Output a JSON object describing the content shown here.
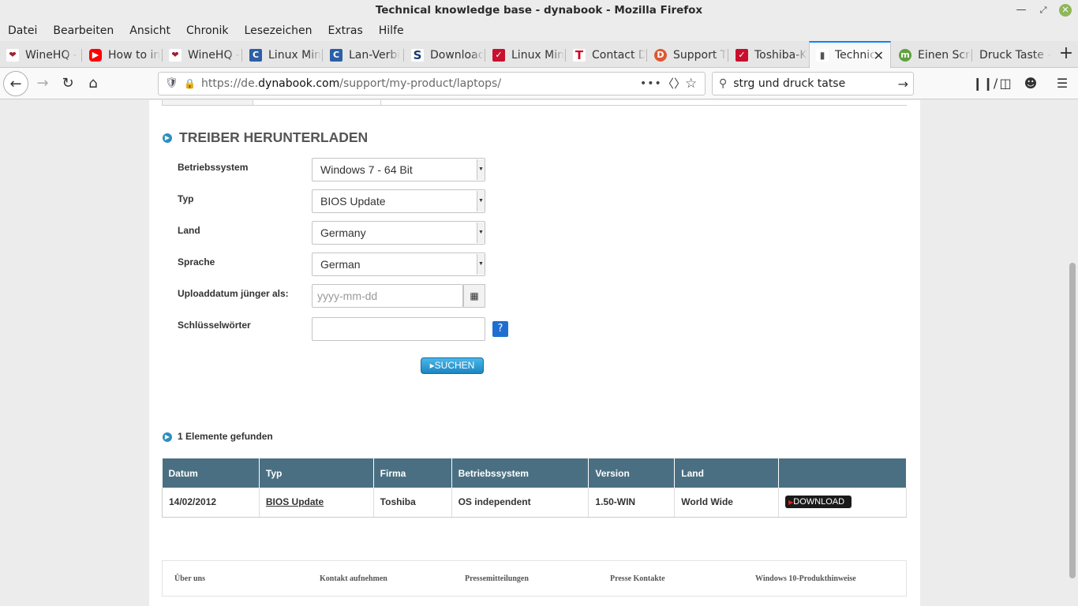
{
  "window": {
    "title": "Technical knowledge base - dynabook - Mozilla Firefox"
  },
  "menu": [
    "Datei",
    "Bearbeiten",
    "Ansicht",
    "Chronik",
    "Lesezeichen",
    "Extras",
    "Hilfe"
  ],
  "tabs": [
    {
      "label": "WineHQ -",
      "icon": "wine-icon",
      "color": "#a0202c"
    },
    {
      "label": "How to in",
      "icon": "youtube-icon",
      "color": "#ff0000"
    },
    {
      "label": "WineHQ -",
      "icon": "wine-icon",
      "color": "#a0202c"
    },
    {
      "label": "Linux Min",
      "icon": "cb-icon",
      "color": "#2b5fa8"
    },
    {
      "label": "Lan-Verbi",
      "icon": "cb-icon",
      "color": "#2b5fa8"
    },
    {
      "label": "Download",
      "icon": "s-icon",
      "color": "#1a3a6e"
    },
    {
      "label": "Linux Min",
      "icon": "toshiba-icon",
      "color": "#c8102e"
    },
    {
      "label": "Contact D",
      "icon": "t-icon",
      "color": "#d0021b"
    },
    {
      "label": "Support T",
      "icon": "duckduckgo-icon",
      "color": "#de5833"
    },
    {
      "label": "Toshiba-K",
      "icon": "toshiba-icon",
      "color": "#c8102e"
    },
    {
      "label": "Technic",
      "icon": "dynabook-icon",
      "color": "#555555",
      "active": true
    },
    {
      "label": "Einen Scre",
      "icon": "mint-icon",
      "color": "#5ea13f"
    },
    {
      "label": "Druck Taste -",
      "icon": "",
      "color": ""
    }
  ],
  "navbar": {
    "url_prefix": "https://de.",
    "url_domain": "dynabook.com",
    "url_path": "/support/my-product/laptops/",
    "search_value": "strg und druck tatse"
  },
  "page": {
    "section_title": "TREIBER HERUNTERLADEN",
    "labels": {
      "os": "Betriebssystem",
      "type": "Typ",
      "country": "Land",
      "language": "Sprache",
      "upload_date": "Uploaddatum jünger als:",
      "keywords": "Schlüsselwörter"
    },
    "selects": {
      "os": "Windows 7 - 64 Bit",
      "type": "BIOS Update",
      "country": "Germany",
      "language": "German"
    },
    "date_placeholder": "yyyy-mm-dd",
    "help": "?",
    "search_button": "SUCHEN",
    "found_text": "1 Elemente gefunden",
    "table_headers": [
      "Datum",
      "Typ",
      "Firma",
      "Betriebssystem",
      "Version",
      "Land",
      ""
    ],
    "rows": [
      {
        "date": "14/02/2012",
        "type": "BIOS Update",
        "company": "Toshiba",
        "os": "OS independent",
        "version": "1.50-WIN",
        "country": "World Wide",
        "action": "DOWNLOAD"
      }
    ],
    "footer_links": [
      "Über uns",
      "Kontakt aufnehmen",
      "Pressemitteilungen",
      "Presse Kontakte",
      "Windows 10-Produkthinweise"
    ]
  }
}
